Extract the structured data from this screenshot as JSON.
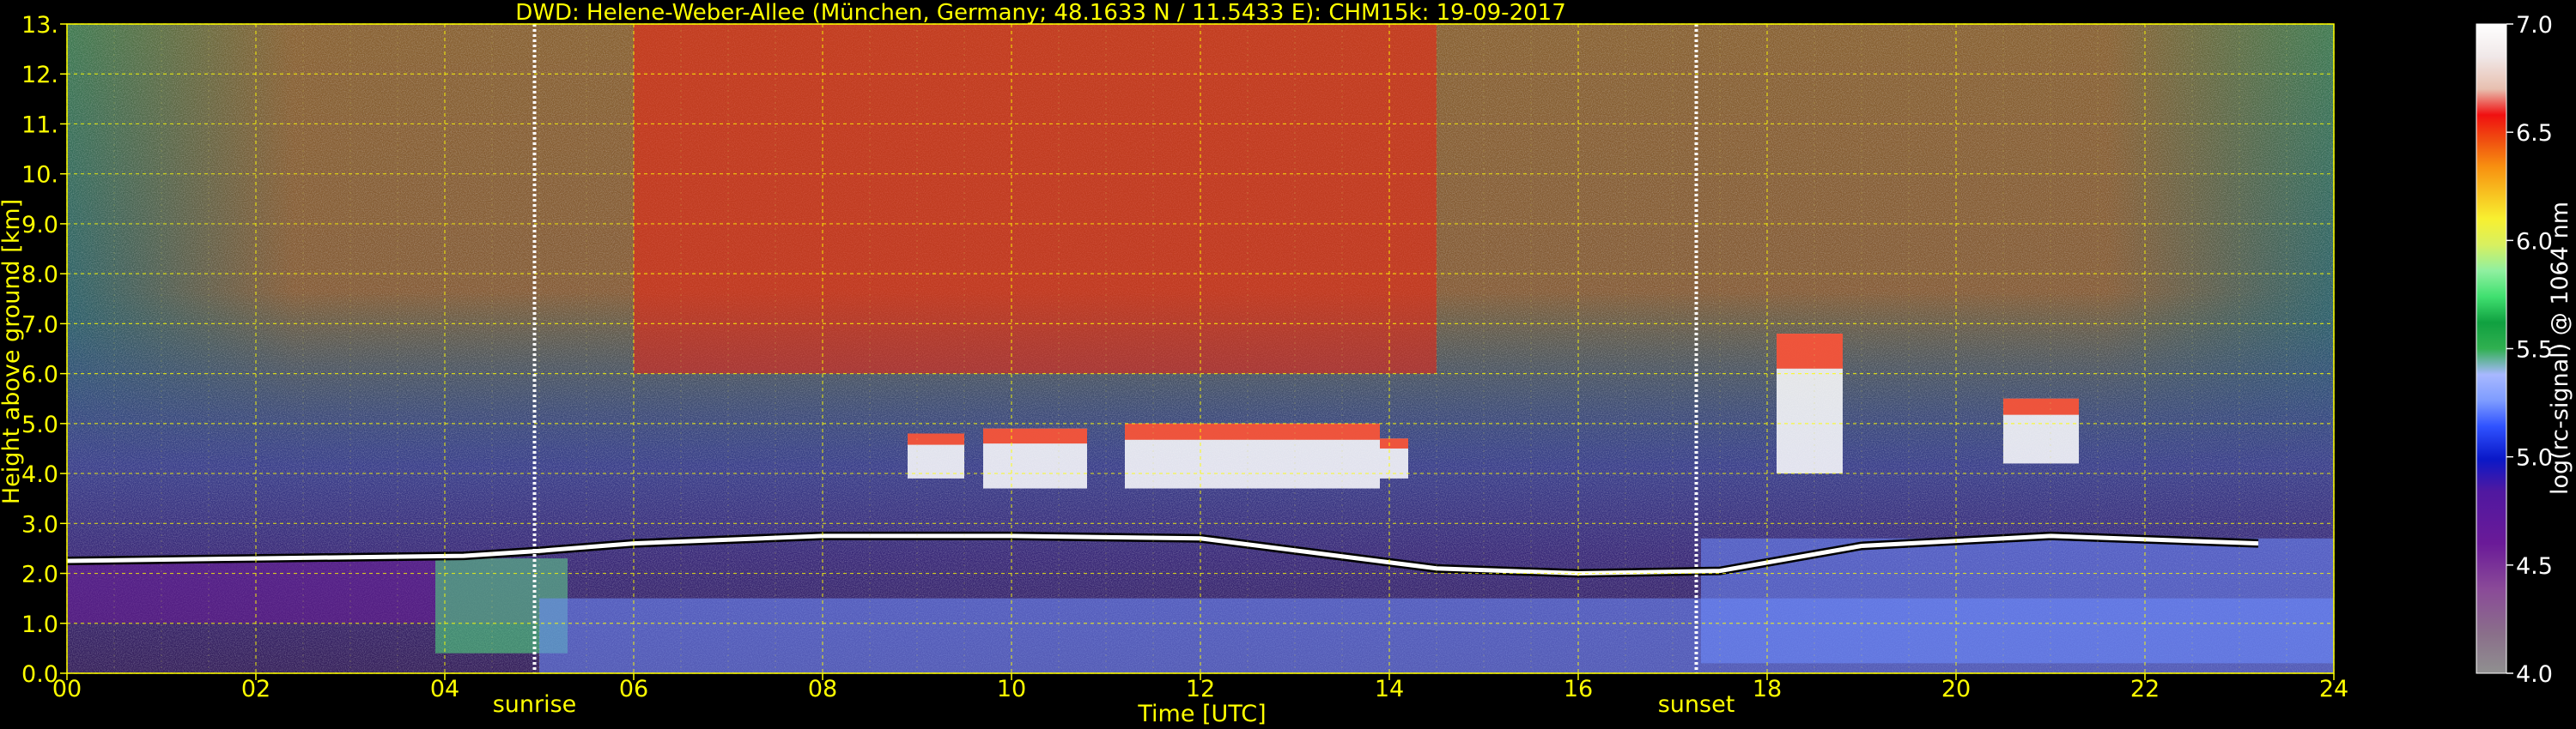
{
  "chart_data": {
    "type": "heatmap",
    "title": "DWD: Helene-Weber-Allee (München, Germany; 48.1633 N / 11.5433 E):    CHM15k: 19-09-2017",
    "xlabel": "Time [UTC]",
    "ylabel": "Height above ground [km]",
    "xlim": [
      0,
      24
    ],
    "ylim": [
      0,
      13
    ],
    "x_ticks": [
      "00",
      "02",
      "04",
      "06",
      "08",
      "10",
      "12",
      "14",
      "16",
      "18",
      "20",
      "22",
      "24"
    ],
    "y_ticks": [
      "0.0",
      "1.0",
      "2.0",
      "3.0",
      "4.0",
      "5.0",
      "6.0",
      "7.0",
      "8.0",
      "9.0",
      "10.",
      "11.",
      "12.",
      "13."
    ],
    "grid": true,
    "annotations": [
      {
        "text": "sunrise",
        "x": 4.95
      },
      {
        "text": "sunset",
        "x": 17.25
      }
    ],
    "colorbar": {
      "label": "log(rc-signal) @ 1064 nm",
      "range": [
        4.0,
        7.0
      ],
      "ticks": [
        "4.0",
        "4.5",
        "5.0",
        "5.5",
        "6.0",
        "6.5",
        "7.0"
      ]
    },
    "features": {
      "cloud_layer_top_km": [
        [
          0.0,
          2.25
        ],
        [
          2.0,
          2.3
        ],
        [
          4.2,
          2.35
        ],
        [
          5.0,
          2.45
        ],
        [
          6.0,
          2.6
        ],
        [
          8.0,
          2.75
        ],
        [
          10.0,
          2.75
        ],
        [
          12.0,
          2.7
        ],
        [
          14.5,
          2.1
        ],
        [
          16.0,
          2.0
        ],
        [
          17.5,
          2.05
        ],
        [
          19.0,
          2.55
        ],
        [
          21.0,
          2.75
        ],
        [
          23.2,
          2.6
        ]
      ],
      "upper_cloud_segments": [
        [
          8.9,
          9.5,
          3.9,
          4.8
        ],
        [
          9.7,
          10.8,
          3.7,
          4.9
        ],
        [
          11.2,
          13.9,
          3.7,
          5.0
        ],
        [
          13.9,
          14.2,
          3.9,
          4.7
        ],
        [
          18.1,
          18.8,
          4.0,
          6.8
        ],
        [
          20.5,
          21.3,
          4.2,
          5.5
        ]
      ],
      "signal_regions": [
        {
          "x": [
            0.0,
            5.3
          ],
          "y": [
            1.0,
            2.3
          ],
          "level": 4.6
        },
        {
          "x": [
            3.9,
            5.3
          ],
          "y": [
            0.4,
            2.3
          ],
          "level": 5.7
        },
        {
          "x": [
            5.0,
            24.0
          ],
          "y": [
            0.0,
            1.5
          ],
          "level": 5.1
        },
        {
          "x": [
            6.0,
            14.5
          ],
          "y": [
            6.0,
            13.0
          ],
          "level": 6.3
        },
        {
          "x": [
            17.3,
            24.0
          ],
          "y": [
            0.2,
            2.7
          ],
          "level": 5.0
        }
      ]
    }
  }
}
